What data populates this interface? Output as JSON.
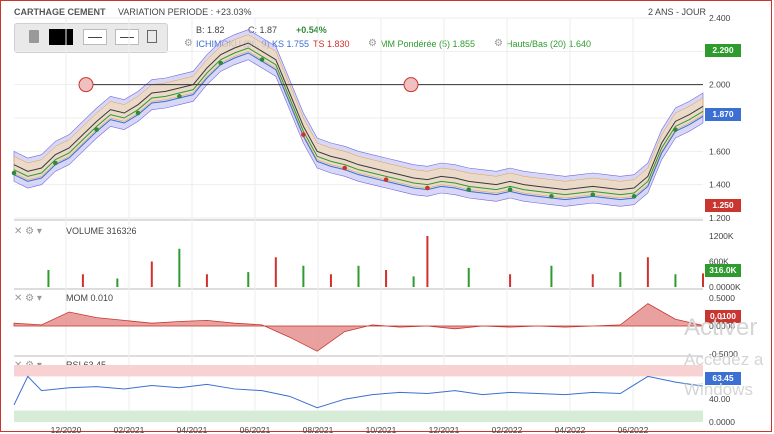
{
  "header": {
    "title": "CARTHAGE CEMENT",
    "variation": "VARIATION PERIODE : +23.03%",
    "period": "2 ANS - JOUR",
    "ohlc_b": "B: 1.82",
    "ohlc_c": "C: 1.87",
    "change": "+0.54%"
  },
  "legend": {
    "ichimoku": "ICHIMOKU (28, 9) KS 1.755 TS 1.830",
    "ichimoku_a": "ICHIMOKU (28, 9) KS 1.755",
    "ichimoku_b": "TS 1.830",
    "mm": "MM Pondérée (5) 1.855",
    "hb": "Hauts/Bas (20) 1.640"
  },
  "badges": {
    "last": "1.870",
    "high": "2.290",
    "low": "1.250",
    "volume": "316.0K",
    "mom": "0.0100",
    "rsi": "63.45"
  },
  "panels": {
    "volume_label": "VOLUME 316326",
    "mom_label": "MOM 0.010",
    "rsi_label": "RSI 63.45"
  },
  "watermark": {
    "line1": "Activer",
    "line2": "Accédez a",
    "line3": "Windows"
  },
  "colors": {
    "price": "#3a3a3a",
    "ichimoku": "#3b6fd1",
    "mm": "#2e9b2e",
    "hb": "#e0a040",
    "buy": "#2e8b3a",
    "sell": "#d0312d",
    "volume_up": "#2e9b2e",
    "volume_down": "#d0312d",
    "rsi": "#3b6fd1"
  },
  "chart_data": {
    "type": "line",
    "x_ticks": [
      "12/2020",
      "02/2021",
      "04/2021",
      "06/2021",
      "08/2021",
      "10/2021",
      "12/2021",
      "02/2022",
      "04/2022",
      "06/2022"
    ],
    "price_axis": {
      "ticks": [
        1.2,
        1.4,
        1.6,
        1.8,
        2.0,
        2.2,
        2.4
      ],
      "ylim": [
        1.2,
        2.4
      ]
    },
    "volume_axis": {
      "ticks": [
        "0.0000K",
        "600K",
        "1200K"
      ],
      "ylim": [
        0,
        1200
      ]
    },
    "mom_axis": {
      "ticks": [
        "-0.5000",
        "0.0000",
        "0.5000"
      ],
      "ylim": [
        -0.5,
        0.5
      ]
    },
    "rsi_axis": {
      "ticks": [
        "0.0000",
        "40.00",
        "80.00"
      ],
      "ylim": [
        0,
        100
      ]
    },
    "horizontal_line": 2.0,
    "series": [
      {
        "name": "CARTHAGE CEMENT",
        "x": [
          0,
          5,
          10,
          15,
          20,
          25,
          30,
          35,
          40,
          45,
          50,
          55,
          60,
          65,
          70,
          75,
          80,
          85,
          90,
          95,
          100
        ],
        "values": [
          1.55,
          1.5,
          1.6,
          1.8,
          1.85,
          1.95,
          2.0,
          2.05,
          2.2,
          2.25,
          2.25,
          2.15,
          1.95,
          1.55,
          1.6,
          1.5,
          1.45,
          1.45,
          1.4,
          1.4,
          1.38
        ]
      }
    ],
    "price_points": [
      [
        0,
        1.52
      ],
      [
        2,
        1.48
      ],
      [
        4,
        1.5
      ],
      [
        6,
        1.58
      ],
      [
        8,
        1.62
      ],
      [
        10,
        1.7
      ],
      [
        12,
        1.78
      ],
      [
        14,
        1.85
      ],
      [
        16,
        1.83
      ],
      [
        18,
        1.88
      ],
      [
        20,
        1.95
      ],
      [
        22,
        1.96
      ],
      [
        24,
        1.98
      ],
      [
        26,
        2.0
      ],
      [
        28,
        2.1
      ],
      [
        30,
        2.18
      ],
      [
        32,
        2.22
      ],
      [
        34,
        2.25
      ],
      [
        36,
        2.2
      ],
      [
        38,
        2.15
      ],
      [
        40,
        1.95
      ],
      [
        42,
        1.75
      ],
      [
        44,
        1.6
      ],
      [
        46,
        1.57
      ],
      [
        48,
        1.55
      ],
      [
        50,
        1.52
      ],
      [
        52,
        1.5
      ],
      [
        54,
        1.48
      ],
      [
        56,
        1.46
      ],
      [
        58,
        1.44
      ],
      [
        60,
        1.43
      ],
      [
        62,
        1.45
      ],
      [
        64,
        1.44
      ],
      [
        66,
        1.42
      ],
      [
        68,
        1.41
      ],
      [
        70,
        1.4
      ],
      [
        72,
        1.42
      ],
      [
        74,
        1.4
      ],
      [
        76,
        1.39
      ],
      [
        78,
        1.38
      ],
      [
        80,
        1.37
      ],
      [
        82,
        1.38
      ],
      [
        84,
        1.39
      ],
      [
        86,
        1.38
      ],
      [
        88,
        1.37
      ],
      [
        90,
        1.38
      ],
      [
        92,
        1.45
      ],
      [
        94,
        1.65
      ],
      [
        96,
        1.78
      ],
      [
        98,
        1.82
      ],
      [
        100,
        1.87
      ]
    ],
    "volume": [
      {
        "x": 5,
        "v": 400
      },
      {
        "x": 10,
        "v": 300
      },
      {
        "x": 15,
        "v": 200
      },
      {
        "x": 20,
        "v": 600
      },
      {
        "x": 24,
        "v": 900
      },
      {
        "x": 28,
        "v": 300
      },
      {
        "x": 34,
        "v": 350
      },
      {
        "x": 38,
        "v": 700
      },
      {
        "x": 42,
        "v": 500
      },
      {
        "x": 46,
        "v": 300
      },
      {
        "x": 50,
        "v": 500
      },
      {
        "x": 54,
        "v": 400
      },
      {
        "x": 58,
        "v": 250
      },
      {
        "x": 60,
        "v": 1200
      },
      {
        "x": 66,
        "v": 450
      },
      {
        "x": 72,
        "v": 300
      },
      {
        "x": 78,
        "v": 500
      },
      {
        "x": 84,
        "v": 300
      },
      {
        "x": 88,
        "v": 350
      },
      {
        "x": 92,
        "v": 700
      },
      {
        "x": 96,
        "v": 300
      },
      {
        "x": 100,
        "v": 320
      }
    ],
    "mom": [
      [
        0,
        0.05
      ],
      [
        4,
        0.02
      ],
      [
        8,
        0.25
      ],
      [
        12,
        0.15
      ],
      [
        16,
        0.1
      ],
      [
        20,
        0.05
      ],
      [
        24,
        0.08
      ],
      [
        28,
        0.1
      ],
      [
        32,
        0.05
      ],
      [
        36,
        0.02
      ],
      [
        40,
        -0.2
      ],
      [
        44,
        -0.45
      ],
      [
        48,
        -0.1
      ],
      [
        52,
        0.02
      ],
      [
        56,
        -0.02
      ],
      [
        60,
        0.0
      ],
      [
        64,
        -0.05
      ],
      [
        68,
        0.0
      ],
      [
        72,
        -0.02
      ],
      [
        76,
        0.0
      ],
      [
        80,
        -0.02
      ],
      [
        84,
        0.0
      ],
      [
        88,
        0.02
      ],
      [
        92,
        0.4
      ],
      [
        96,
        0.12
      ],
      [
        100,
        0.01
      ]
    ],
    "rsi": [
      [
        0,
        30
      ],
      [
        2,
        80
      ],
      [
        4,
        55
      ],
      [
        8,
        60
      ],
      [
        12,
        62
      ],
      [
        16,
        58
      ],
      [
        20,
        64
      ],
      [
        24,
        60
      ],
      [
        28,
        66
      ],
      [
        32,
        58
      ],
      [
        36,
        55
      ],
      [
        40,
        45
      ],
      [
        44,
        25
      ],
      [
        48,
        40
      ],
      [
        52,
        48
      ],
      [
        56,
        52
      ],
      [
        60,
        50
      ],
      [
        64,
        55
      ],
      [
        68,
        48
      ],
      [
        72,
        52
      ],
      [
        76,
        50
      ],
      [
        80,
        48
      ],
      [
        84,
        52
      ],
      [
        88,
        50
      ],
      [
        92,
        80
      ],
      [
        94,
        75
      ],
      [
        96,
        70
      ],
      [
        100,
        63
      ]
    ]
  }
}
